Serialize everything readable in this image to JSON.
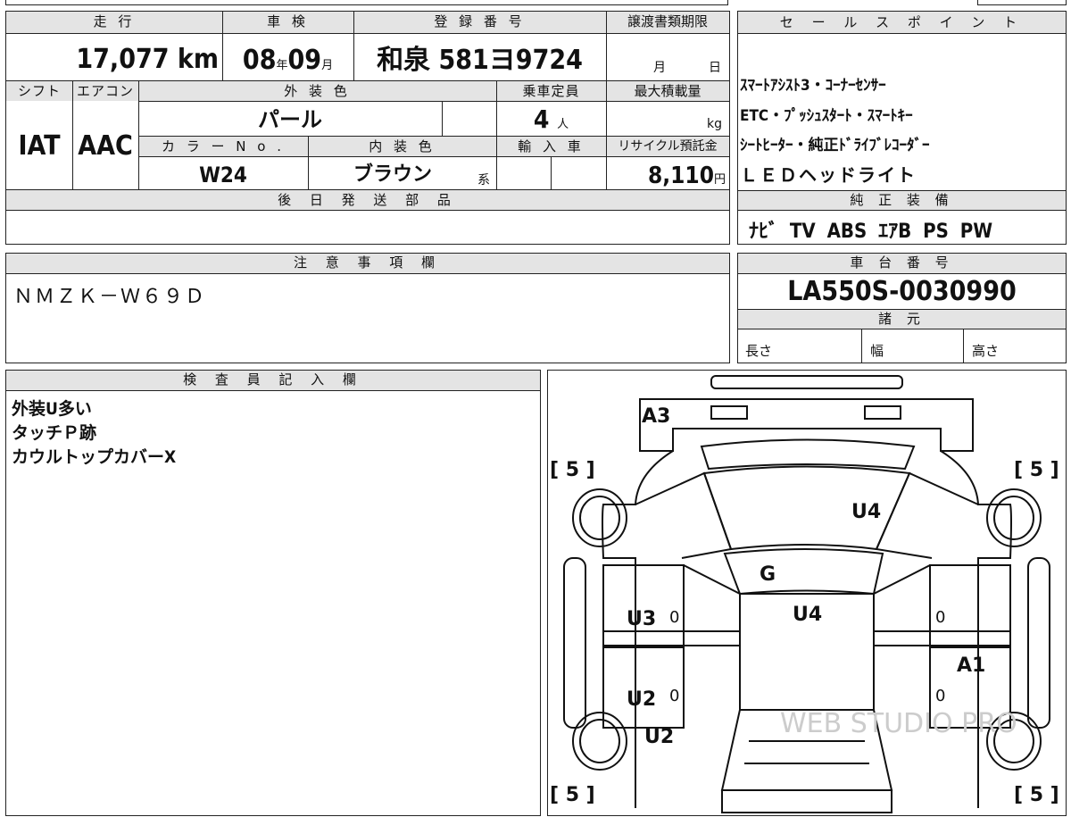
{
  "vehicle": {
    "labels": {
      "mileage": "走 行",
      "shaken": "車 検",
      "registration": "登 録 番 号",
      "transfer_deadline": "譲渡書類期限",
      "shift": "シフト",
      "aircon": "エアコン",
      "exterior_color": "外 装 色",
      "capacity": "乗車定員",
      "max_load": "最大積載量",
      "color_no": "カ ラ ー N o .",
      "interior_color": "内 装 色",
      "import": "輸 入 車",
      "recycle": "リサイクル預託金",
      "later_parts": "後 日 発 送 部 品"
    },
    "mileage": "17,077",
    "mileage_unit": "km",
    "shaken_year": "08",
    "shaken_year_unit": "年",
    "shaken_month": "09",
    "shaken_month_unit": "月",
    "registration_number": "和泉 581ヨ9724",
    "deadline_month_unit": "月",
    "deadline_day_unit": "日",
    "shift": "IAT",
    "aircon": "AAC",
    "exterior_color": "パール",
    "capacity": "4",
    "capacity_unit": "人",
    "max_load_unit": "kg",
    "color_no": "W24",
    "interior_color": "ブラウン",
    "interior_suffix": "系",
    "recycle_fee": "8,110",
    "recycle_unit": "円"
  },
  "sales_points": {
    "header": "セ ー ル ス ポ イ ン ト",
    "lines": [
      "ｽﾏｰﾄｱｼｽﾄ3・ｺｰﾅｰｾﾝｻｰ",
      "ETC・ﾌﾟｯｼｭｽﾀｰﾄ・ｽﾏｰﾄｷｰ",
      "ｼｰﾄﾋｰﾀｰ・純正ﾄﾞﾗｲﾌﾞﾚｺｰﾀﾞｰ",
      "ＬＥＤヘッドライト"
    ]
  },
  "equipment": {
    "header": "純 正 装 備",
    "items": "ﾅﾋﾞ TV ABS ｴｱB PS PW"
  },
  "notes": {
    "header": "注 意 事 項 欄",
    "text": "ＮＭＺＫ－Ｗ６９Ｄ"
  },
  "chassis": {
    "header": "車 台 番 号",
    "number": "LA550S-0030990",
    "specs_header": "諸 元",
    "length_label": "長さ",
    "width_label": "幅",
    "height_label": "高さ"
  },
  "inspector": {
    "header": "検 査 員 記 入 欄",
    "lines": [
      "外装U多い",
      "タッチＰ跡",
      "カウルトップカバーX"
    ]
  },
  "diagram": {
    "marks": {
      "a3": "A3",
      "u4_roof": "U4",
      "g": "G",
      "u4_hood": "U4",
      "u3": "U3",
      "u2_door": "U2",
      "u2_fender": "U2",
      "a1": "A1",
      "zero_1": "0",
      "zero_2": "0",
      "zero_3": "0",
      "zero_4": "0"
    },
    "tires": {
      "rear_left": "[ 5 ]",
      "rear_right": "[ 5 ]",
      "front_left": "[ 5 ]",
      "front_right": "[ 5 ]"
    },
    "watermark": "WEB STUDIO PRO"
  }
}
